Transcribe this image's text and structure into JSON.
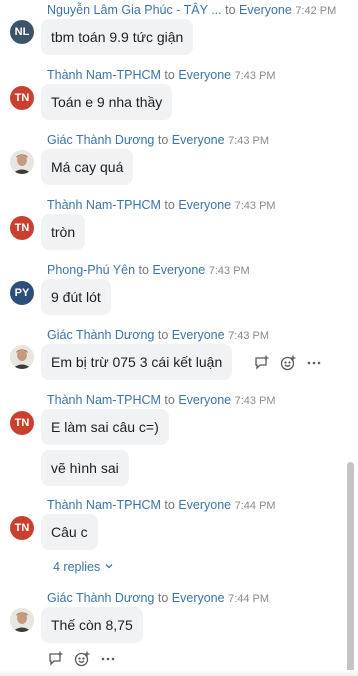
{
  "messages": [
    {
      "sender": "Nguyễn Lâm Gia Phúc - TÂY ...",
      "to": "to",
      "target": "Everyone",
      "time": "7:42 PM",
      "avatar": "NL",
      "texts": [
        "tbm toán 9.9 tức giận"
      ]
    },
    {
      "sender": "Thành Nam-TPHCM",
      "to": "to",
      "target": "Everyone",
      "time": "7:43 PM",
      "avatar": "TN",
      "texts": [
        "Toán e 9 nha thầy"
      ]
    },
    {
      "sender": "Giác Thành Dương",
      "to": "to",
      "target": "Everyone",
      "time": "7:43 PM",
      "avatar": "photo",
      "texts": [
        "Má cay quá"
      ]
    },
    {
      "sender": "Thành Nam-TPHCM",
      "to": "to",
      "target": "Everyone",
      "time": "7:43 PM",
      "avatar": "TN",
      "texts": [
        "tròn"
      ]
    },
    {
      "sender": "Phong-Phú Yên",
      "to": "to",
      "target": "Everyone",
      "time": "7:43 PM",
      "avatar": "PY",
      "texts": [
        "9 đút lót"
      ]
    },
    {
      "sender": "Giác Thành Dương",
      "to": "to",
      "target": "Everyone",
      "time": "7:43 PM",
      "avatar": "photo",
      "texts": [
        "Em bị trừ 075 3 cái kết luận"
      ]
    },
    {
      "sender": "Thành Nam-TPHCM",
      "to": "to",
      "target": "Everyone",
      "time": "7:43 PM",
      "avatar": "TN",
      "texts": [
        "E làm sai câu c=)",
        "vẽ hình sai"
      ]
    },
    {
      "sender": "Thành Nam-TPHCM",
      "to": "to",
      "target": "Everyone",
      "time": "7:44 PM",
      "avatar": "TN",
      "texts": [
        "Câu c"
      ],
      "replies_label": "4 replies"
    },
    {
      "sender": "Giác Thành Dương",
      "to": "to",
      "target": "Everyone",
      "time": "7:44 PM",
      "avatar": "photo",
      "texts": [
        "Thế còn 8,75"
      ]
    }
  ],
  "icons": {
    "reply": "reply-icon",
    "emoji": "emoji-icon",
    "more": "more-icon",
    "chevron": "chevron-down-icon"
  },
  "colors": {
    "sender": "#3a74a8",
    "bubble": "#f1f2f4",
    "avatar_tn": "#c9402f",
    "avatar_nl": "#3d5468",
    "avatar_py": "#2d4e7a"
  }
}
